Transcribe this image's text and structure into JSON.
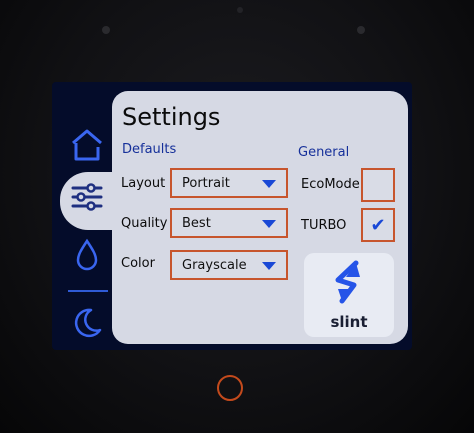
{
  "settings": {
    "title": "Settings",
    "defaults_heading": "Defaults",
    "general_heading": "General",
    "fields": [
      {
        "label": "Layout",
        "value": "Portrait"
      },
      {
        "label": "Quality",
        "value": "Best"
      },
      {
        "label": "Color",
        "value": "Grayscale"
      }
    ],
    "toggles": [
      {
        "label": "EcoMode",
        "checked": false,
        "mark": ""
      },
      {
        "label": "TURBO",
        "checked": true,
        "mark": "✔"
      }
    ]
  },
  "logo": {
    "text": "slint"
  },
  "nav": {
    "items": [
      {
        "icon": "home-icon"
      },
      {
        "icon": "sliders-icon",
        "selected": true
      },
      {
        "icon": "drop-icon"
      },
      {
        "icon": "moon-icon"
      }
    ]
  },
  "colors": {
    "accent": "#1948d6",
    "border": "#c7552d",
    "panel": "#d6d9e4",
    "screen_bg": "#040c2a"
  }
}
